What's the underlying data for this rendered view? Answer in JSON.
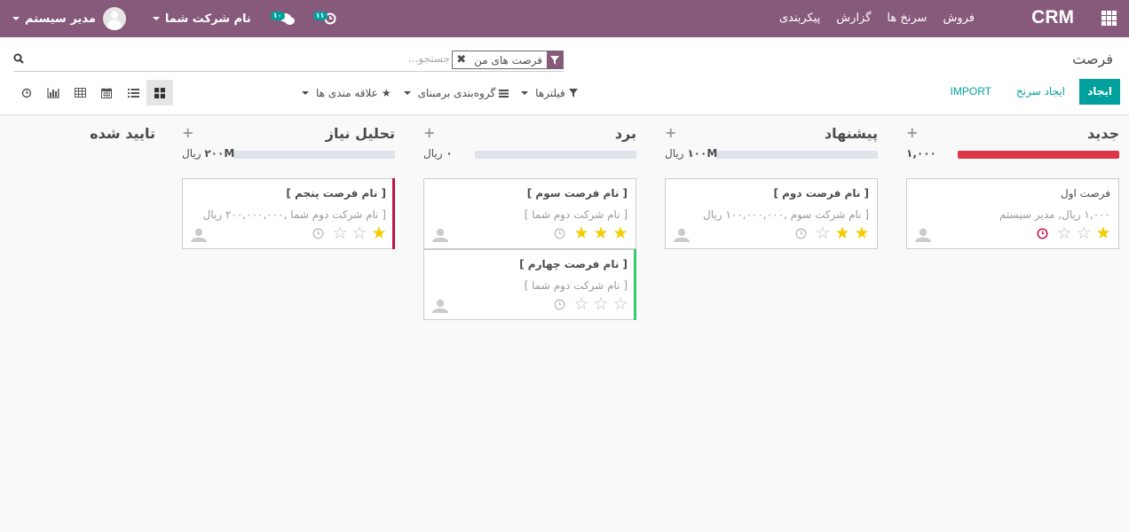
{
  "navbar": {
    "brand": "CRM",
    "menu": [
      {
        "label": "فروش"
      },
      {
        "label": "سرنخ ها"
      },
      {
        "label": "گزارش"
      },
      {
        "label": "پیکربندی"
      }
    ],
    "user_label": "مدیر سیستم",
    "company_label": "نام شرکت شما",
    "messages_badge": "۱۰",
    "activities_badge": "۱۱",
    "colors": {
      "bar": "#875a7b",
      "badge": "#00a09d"
    }
  },
  "control_panel": {
    "breadcrumb": "فرصت",
    "search": {
      "placeholder": "جستجو...",
      "facet_label": "فرصت های من"
    },
    "buttons": {
      "create": "ایجاد",
      "quick_create": "ایجاد سرنخ",
      "import": "IMPORT"
    },
    "filters": [
      {
        "label": "فیلترها",
        "icon": "filter-icon"
      },
      {
        "label": "گروه‌بندی برمبنای",
        "icon": "bars-icon"
      },
      {
        "label": "علاقه مندی ها",
        "icon": "star-icon"
      }
    ],
    "views": [
      "kanban-view-icon",
      "list-view-icon",
      "calendar-view-icon",
      "pivot-view-icon",
      "graph-view-icon",
      "activity-view-icon"
    ]
  },
  "kanban": {
    "columns": [
      {
        "title": "جدید",
        "add": "+",
        "sum_value": "۱,۰۰۰",
        "sum_unit": "ریال",
        "progress_fill": 1.0,
        "cards": [
          {
            "name": "فرصت اول",
            "desc": "۱,۰۰۰ ریال, مدیر سیستم",
            "stars": 1,
            "accent": ""
          }
        ]
      },
      {
        "title": "پیشنهاد",
        "add": "+",
        "sum_value": "۱۰۰M",
        "sum_unit": "ریال",
        "progress_fill": 0,
        "cards": [
          {
            "name": "[ نام فرصت دوم ]",
            "desc": "[ نام شرکت سوم ,۱۰۰,۰۰۰,۰۰۰ ریال",
            "stars": 2,
            "accent": ""
          }
        ]
      },
      {
        "title": "برد",
        "add": "+",
        "sum_value": "۰",
        "sum_unit": "ریال",
        "progress_fill": 0,
        "cards": [
          {
            "name": "[ نام فرصت سوم ]",
            "desc": "[ نام شرکت دوم شما ]",
            "stars": 3,
            "accent": ""
          },
          {
            "name": "[ نام فرصت چهارم ]",
            "desc": "[ نام شرکت دوم شما ]",
            "stars": 0,
            "accent": "#2ecc71"
          }
        ]
      },
      {
        "title": "تحلیل نیاز",
        "add": "+",
        "sum_value": "۲۰۰M",
        "sum_unit": "ریال",
        "progress_fill": 0,
        "cards": [
          {
            "name": "[ نام فرصت پنجم ]",
            "desc": "[ نام شرکت دوم شما ,۲۰۰,۰۰۰,۰۰۰ ریال",
            "stars": 1,
            "accent": "#c0124a"
          }
        ]
      },
      {
        "title": "تایید شده",
        "add": "",
        "sum_value": "",
        "sum_unit": "",
        "progress_fill": 0,
        "cards": []
      }
    ]
  }
}
